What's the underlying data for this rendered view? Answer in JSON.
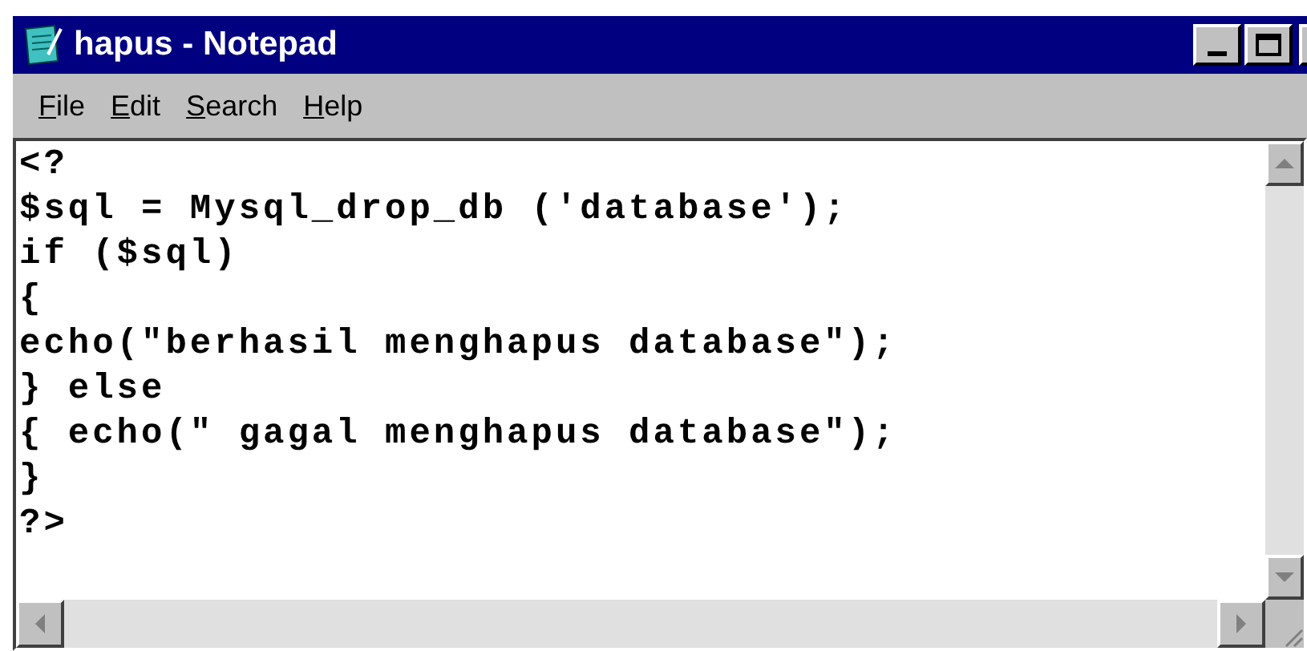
{
  "window": {
    "title": "hapus - Notepad"
  },
  "menu": [
    {
      "label": "File"
    },
    {
      "label": "Edit"
    },
    {
      "label": "Search"
    },
    {
      "label": "Help"
    }
  ],
  "editor": {
    "lines": [
      "<?",
      "$sql = Mysql_drop_db ('database');",
      "if ($sql)",
      "{",
      "echo(\"berhasil menghapus database\");",
      "} else",
      "{ echo(\" gagal menghapus database\");",
      "}",
      "?>"
    ]
  }
}
